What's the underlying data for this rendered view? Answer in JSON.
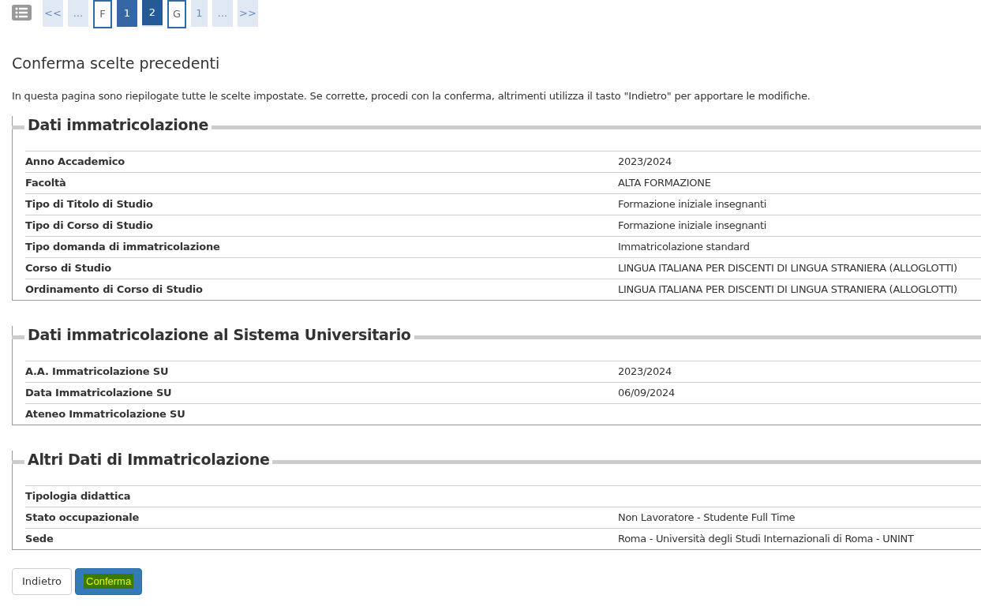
{
  "pagination": [
    {
      "label": "<<",
      "kind": "plain",
      "selected": false
    },
    {
      "label": "...",
      "kind": "plain",
      "selected": false
    },
    {
      "label": "F",
      "kind": "outlined",
      "selected": false
    },
    {
      "label": "1",
      "kind": "filled",
      "selected": false
    },
    {
      "label": "2",
      "kind": "filled",
      "selected": true
    },
    {
      "label": "G",
      "kind": "outlined",
      "selected": false
    },
    {
      "label": "1",
      "kind": "plain",
      "selected": false
    },
    {
      "label": "...",
      "kind": "plain",
      "selected": false
    },
    {
      "label": ">>",
      "kind": "plain",
      "selected": false
    }
  ],
  "title": "Conferma scelte precedenti",
  "intro": "In questa pagina sono riepilogate tutte le scelte impostate. Se corrette, procedi con la conferma, altrimenti utilizza il tasto \"Indietro\" per apportare le modifiche.",
  "sections": [
    {
      "legend": "Dati immatricolazione",
      "rows": [
        {
          "label": "Anno Accademico",
          "value": "2023/2024"
        },
        {
          "label": "Facoltà",
          "value": "ALTA FORMAZIONE"
        },
        {
          "label": "Tipo di Titolo di Studio",
          "value": "Formazione iniziale insegnanti"
        },
        {
          "label": "Tipo di Corso di Studio",
          "value": "Formazione iniziale insegnanti"
        },
        {
          "label": "Tipo domanda di immatricolazione",
          "value": "Immatricolazione standard"
        },
        {
          "label": "Corso di Studio",
          "value": "LINGUA ITALIANA PER DISCENTI DI LINGUA STRANIERA (ALLOGLOTTI)"
        },
        {
          "label": "Ordinamento di Corso di Studio",
          "value": "LINGUA ITALIANA PER DISCENTI DI LINGUA STRANIERA (ALLOGLOTTI)"
        }
      ]
    },
    {
      "legend": "Dati immatricolazione al Sistema Universitario",
      "rows": [
        {
          "label": "A.A. Immatricolazione SU",
          "value": "2023/2024"
        },
        {
          "label": "Data Immatricolazione SU",
          "value": "06/09/2024"
        },
        {
          "label": "Ateneo Immatricolazione SU"
        }
      ]
    },
    {
      "legend": "Altri Dati di Immatricolazione",
      "rows": [
        {
          "label": "Tipologia didattica"
        },
        {
          "label": "Stato occupazionale",
          "value": "Non Lavoratore - Studente Full Time"
        },
        {
          "label": "Sede",
          "value": "Roma - Università degli Studi Internazionali di Roma - UNINT"
        }
      ]
    }
  ],
  "buttons": [
    {
      "label": "Indietro",
      "kind": "default"
    },
    {
      "label": "Conferma",
      "kind": "primary"
    }
  ]
}
